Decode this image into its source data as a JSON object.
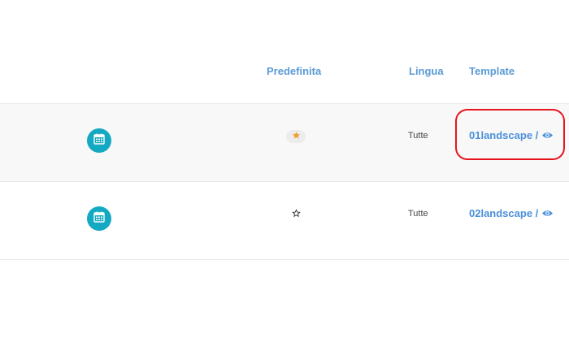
{
  "table": {
    "headers": {
      "default": "Predefinita",
      "language": "Lingua",
      "template": "Template"
    },
    "rows": [
      {
        "icon": "calendar-icon",
        "default_star": "filled",
        "language": "Tutte",
        "template": "01landscape /",
        "preview_icon": "eye-icon",
        "highlighted": true
      },
      {
        "icon": "calendar-icon",
        "default_star": "outline",
        "language": "Tutte",
        "template": "02landscape /",
        "preview_icon": "eye-icon",
        "highlighted": false
      }
    ]
  },
  "colors": {
    "header_text": "#5b9bd5",
    "link": "#4a90d9",
    "calendar_button": "#14a9c2",
    "star_filled": "#f0a030",
    "annotation": "#e8141c",
    "row_shade": "#f8f8f8"
  }
}
